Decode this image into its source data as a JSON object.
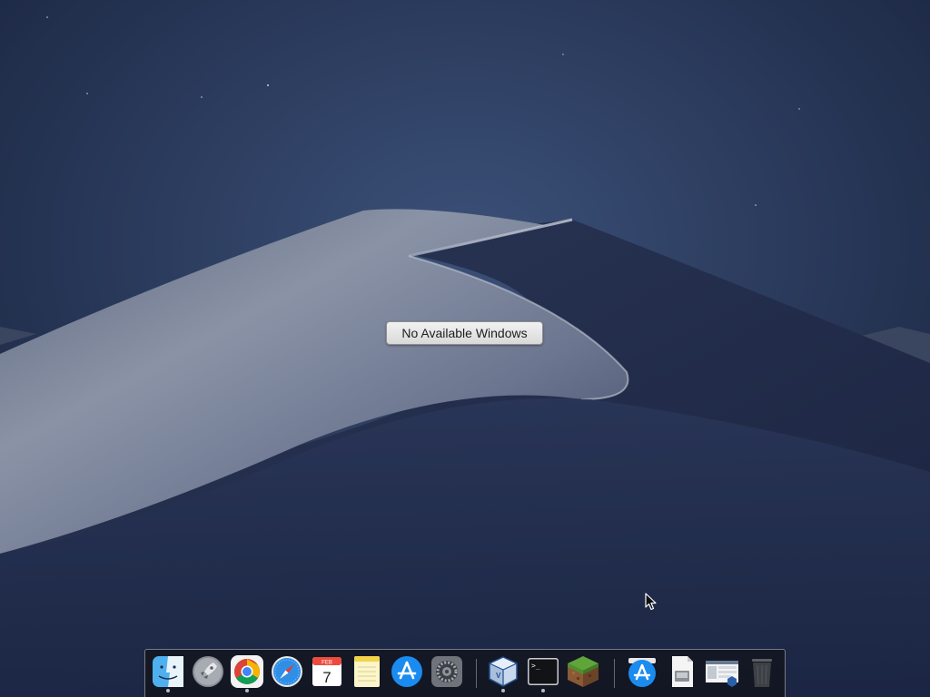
{
  "desktop": {
    "overlay_message": "No Available Windows"
  },
  "dock": {
    "items": [
      {
        "name": "Finder",
        "icon": "finder-icon",
        "running": true
      },
      {
        "name": "Launchpad",
        "icon": "launchpad-icon",
        "running": false
      },
      {
        "name": "Google Chrome",
        "icon": "chrome-icon",
        "running": true
      },
      {
        "name": "Safari",
        "icon": "safari-icon",
        "running": false
      },
      {
        "name": "Calendar",
        "icon": "calendar-icon",
        "running": false,
        "month": "FEB",
        "day": "7"
      },
      {
        "name": "Notes",
        "icon": "notes-icon",
        "running": false
      },
      {
        "name": "App Store",
        "icon": "app-store-icon",
        "running": false
      },
      {
        "name": "System Preferences",
        "icon": "system-preferences-icon",
        "running": false
      },
      {
        "name": "VirtualBox",
        "icon": "virtualbox-icon",
        "running": true
      },
      {
        "name": "Terminal",
        "icon": "terminal-icon",
        "running": true,
        "prompt": ">_"
      },
      {
        "name": "Minecraft",
        "icon": "minecraft-icon",
        "running": false
      },
      {
        "name": "Downloads (App Store)",
        "icon": "app-store-stack-icon",
        "running": false
      },
      {
        "name": "Document",
        "icon": "document-icon",
        "running": false
      },
      {
        "name": "VirtualBox Screenshot",
        "icon": "screenshot-file-icon",
        "running": false
      },
      {
        "name": "Trash",
        "icon": "trash-icon",
        "running": false
      }
    ]
  },
  "colors": {
    "sky_top": "#1b2742",
    "dune_light": "#8f98ab",
    "dune_dark": "#1e2a48",
    "dock_bg": "#12161f"
  }
}
